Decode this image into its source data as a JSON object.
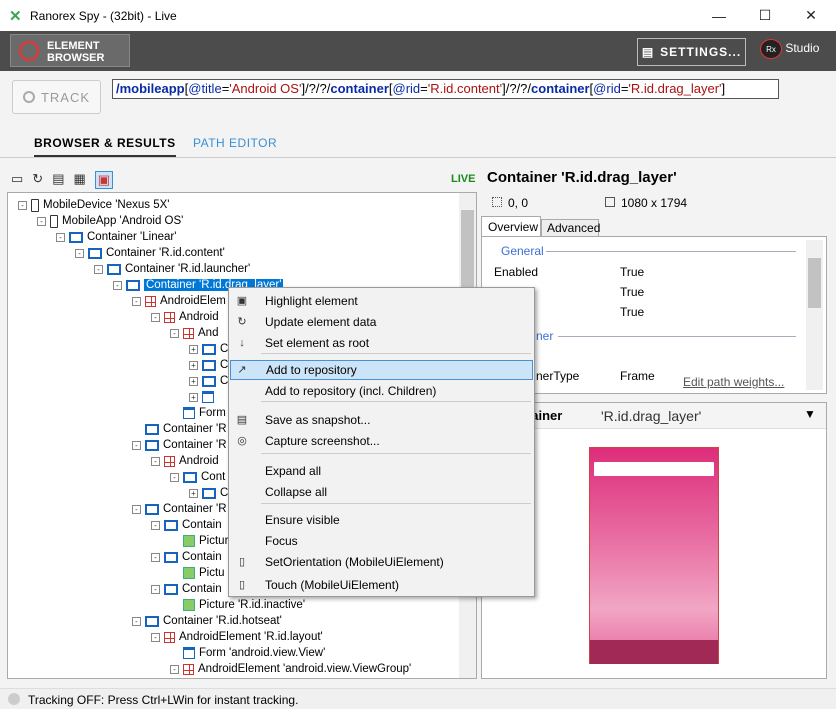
{
  "window": {
    "title": "Ranorex Spy - (32bit) - Live",
    "min": "—",
    "max": "☐",
    "close": "✕"
  },
  "toolbar": {
    "element_browser_1": "ELEMENT",
    "element_browser_2": "BROWSER",
    "settings": "SETTINGS...",
    "studio": "Studio",
    "rx": "Rx"
  },
  "track": {
    "label": "TRACK"
  },
  "path": {
    "p1": "/mobileapp",
    "p2": "[",
    "a1": "@title",
    "eq": "=",
    "v1": "'Android OS'",
    "p3": "]/?/?/",
    "p4": "container",
    "a2": "@rid",
    "v2": "'R.id.content'",
    "p5": "]/?/?/",
    "p6": "container",
    "v3": "'R.id.drag_layer'",
    "p7": "]"
  },
  "tabs": {
    "browser": "BROWSER & RESULTS",
    "path_editor": "PATH EDITOR"
  },
  "live": "LIVE",
  "tree": [
    {
      "t": "MobileDevice 'Nexus 5X'",
      "ic": "ph",
      "ex": "-"
    },
    {
      "t": "MobileApp 'Android OS'",
      "ic": "ph",
      "ex": "-"
    },
    {
      "t": "Container 'Linear'",
      "ic": "ct",
      "ex": "-"
    },
    {
      "t": "Container 'R.id.content'",
      "ic": "ct",
      "ex": "-"
    },
    {
      "t": "Container 'R.id.launcher'",
      "ic": "ct",
      "ex": "-"
    },
    {
      "t": "Container 'R.id.drag_layer'",
      "ic": "ct",
      "ex": "-"
    },
    {
      "t": "AndroidElem",
      "ic": "ae",
      "ex": "-"
    },
    {
      "t": "Android",
      "ic": "ae",
      "ex": "-"
    },
    {
      "t": "And",
      "ic": "ae",
      "ex": "-"
    },
    {
      "t": "C",
      "ic": "ct",
      "ex": "+"
    },
    {
      "t": "C",
      "ic": "ct",
      "ex": "+"
    },
    {
      "t": "C",
      "ic": "ct",
      "ex": "+"
    },
    {
      "t": "",
      "ic": "fm",
      "ex": "+"
    },
    {
      "t": "Form",
      "ic": "fm",
      "ex": ""
    },
    {
      "t": "Container 'R",
      "ic": "ct",
      "ex": ""
    },
    {
      "t": "Container 'R",
      "ic": "ct",
      "ex": "-"
    },
    {
      "t": "Android",
      "ic": "ae",
      "ex": "-"
    },
    {
      "t": "Cont",
      "ic": "ct",
      "ex": "-"
    },
    {
      "t": "C",
      "ic": "ct",
      "ex": "+"
    },
    {
      "t": "Container 'R",
      "ic": "ct",
      "ex": "-"
    },
    {
      "t": "Contain",
      "ic": "ct",
      "ex": "-"
    },
    {
      "t": "Pictur",
      "ic": "pi",
      "ex": ""
    },
    {
      "t": "Contain",
      "ic": "ct",
      "ex": "-"
    },
    {
      "t": "Pictu",
      "ic": "pi",
      "ex": ""
    },
    {
      "t": "Contain",
      "ic": "ct",
      "ex": "-"
    },
    {
      "t": "Picture 'R.id.inactive'",
      "ic": "pi",
      "ex": ""
    },
    {
      "t": "Container 'R.id.hotseat'",
      "ic": "ct",
      "ex": "-"
    },
    {
      "t": "AndroidElement 'R.id.layout'",
      "ic": "ae",
      "ex": "-"
    },
    {
      "t": "Form 'android.view.View'",
      "ic": "fm",
      "ex": ""
    },
    {
      "t": "AndroidElement 'android.view.ViewGroup'",
      "ic": "ae",
      "ex": "-"
    }
  ],
  "right": {
    "title": "Container 'R.id.drag_layer'",
    "pos": "0, 0",
    "size": "1080 x 1794",
    "tab_overview": "Overview",
    "tab_advanced": "Advanced"
  },
  "props": {
    "general": "General",
    "rows": [
      {
        "k": "Enabled",
        "v": "True"
      },
      {
        "k": "",
        "v": "True"
      },
      {
        "k": "",
        "v": "True"
      }
    ],
    "container": "ner",
    "ctype_key": "nerType",
    "ctype_val": "Frame",
    "edit": "Edit path weights..."
  },
  "shot": {
    "label": "ntainer",
    "value": "'R.id.drag_layer'"
  },
  "menu": [
    {
      "l": "Highlight element",
      "ic": "▣"
    },
    {
      "l": "Update element data",
      "ic": "↻"
    },
    {
      "l": "Set element as root",
      "ic": "↓"
    },
    {
      "l": "Add to repository",
      "ic": "↗"
    },
    {
      "l": "Add to repository (incl. Children)",
      "ic": ""
    },
    {
      "l": "Save as snapshot...",
      "ic": "▤"
    },
    {
      "l": "Capture screenshot...",
      "ic": "◎"
    },
    {
      "l": "Expand all",
      "ic": ""
    },
    {
      "l": "Collapse all",
      "ic": ""
    },
    {
      "l": "Ensure visible",
      "ic": ""
    },
    {
      "l": "Focus",
      "ic": ""
    },
    {
      "l": "SetOrientation (MobileUiElement)",
      "ic": "▯"
    },
    {
      "l": "Touch (MobileUiElement)",
      "ic": "▯"
    }
  ],
  "status": "Tracking OFF: Press Ctrl+LWin for instant tracking."
}
